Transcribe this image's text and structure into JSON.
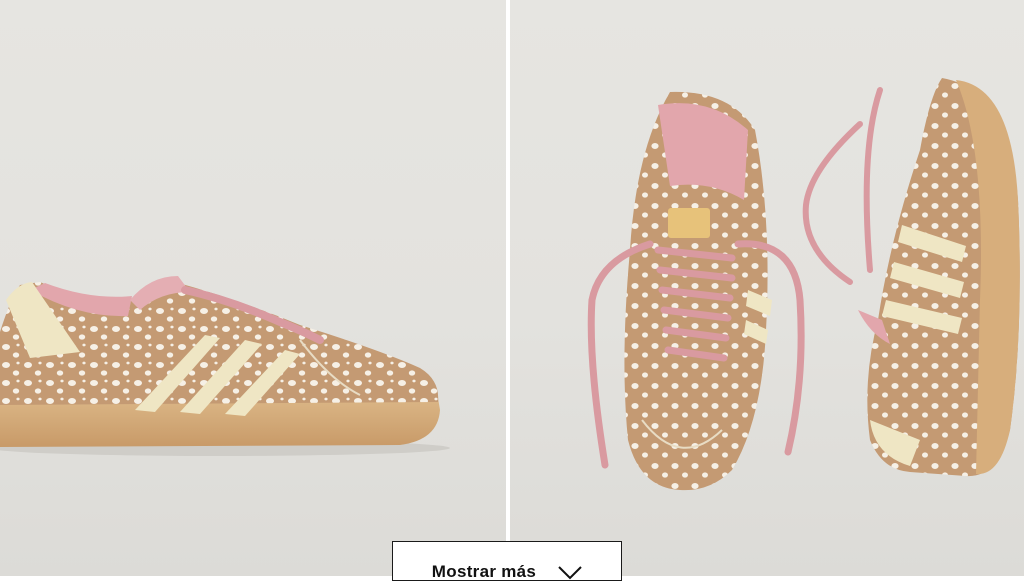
{
  "gallery": {
    "show_more_label": "Mostrar más",
    "show_more_icon": "chevron-down-icon"
  },
  "product": {
    "shoe_colors": {
      "fur": "#c9a07a",
      "spots": "#f6f0e6",
      "stripes": "#efe6c4",
      "lining": "#e2a6ac",
      "laces": "#d99aa0",
      "sole": "#d7ae7c",
      "tongue_label": "#e7c27a"
    }
  }
}
